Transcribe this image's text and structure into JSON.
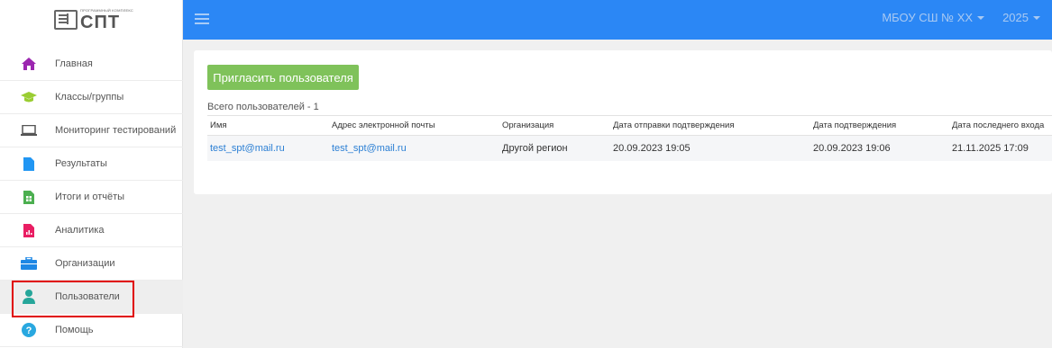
{
  "logo": {
    "small_text": "ПРОГРАММНЫЙ КОМПЛЕКС",
    "text": "СПТ"
  },
  "sidebar": {
    "items": [
      {
        "label": "Главная",
        "icon": "home-icon",
        "color": "#9c27b0"
      },
      {
        "label": "Классы/группы",
        "icon": "graduation-cap-icon",
        "color": "#9acd32"
      },
      {
        "label": "Мониторинг тестирований",
        "icon": "laptop-icon",
        "color": "#555555"
      },
      {
        "label": "Результаты",
        "icon": "document-icon",
        "color": "#2196f3"
      },
      {
        "label": "Итоги и отчёты",
        "icon": "spreadsheet-icon",
        "color": "#4caf50"
      },
      {
        "label": "Аналитика",
        "icon": "chart-document-icon",
        "color": "#e91e63"
      },
      {
        "label": "Организации",
        "icon": "briefcase-icon",
        "color": "#1e88e5"
      },
      {
        "label": "Пользователи",
        "icon": "user-icon",
        "color": "#26a69a"
      },
      {
        "label": "Помощь",
        "icon": "question-icon",
        "color": "#29a8e0"
      }
    ]
  },
  "header": {
    "org": "МБОУ СШ № ХХ",
    "year": "2025",
    "accent": "#2b87f5"
  },
  "main": {
    "invite_button": "Пригласить пользователя",
    "total": "Всего пользователей - 1",
    "columns": [
      "Имя",
      "Адрес электронной почты",
      "Организация",
      "Дата отправки подтверждения",
      "Дата подтверждения",
      "Дата последнего входа"
    ],
    "rows": [
      [
        "test_spt@mail.ru",
        "test_spt@mail.ru",
        "Другой регион",
        "20.09.2023 19:05",
        "20.09.2023 19:06",
        "21.11.2025 17:09"
      ]
    ]
  }
}
